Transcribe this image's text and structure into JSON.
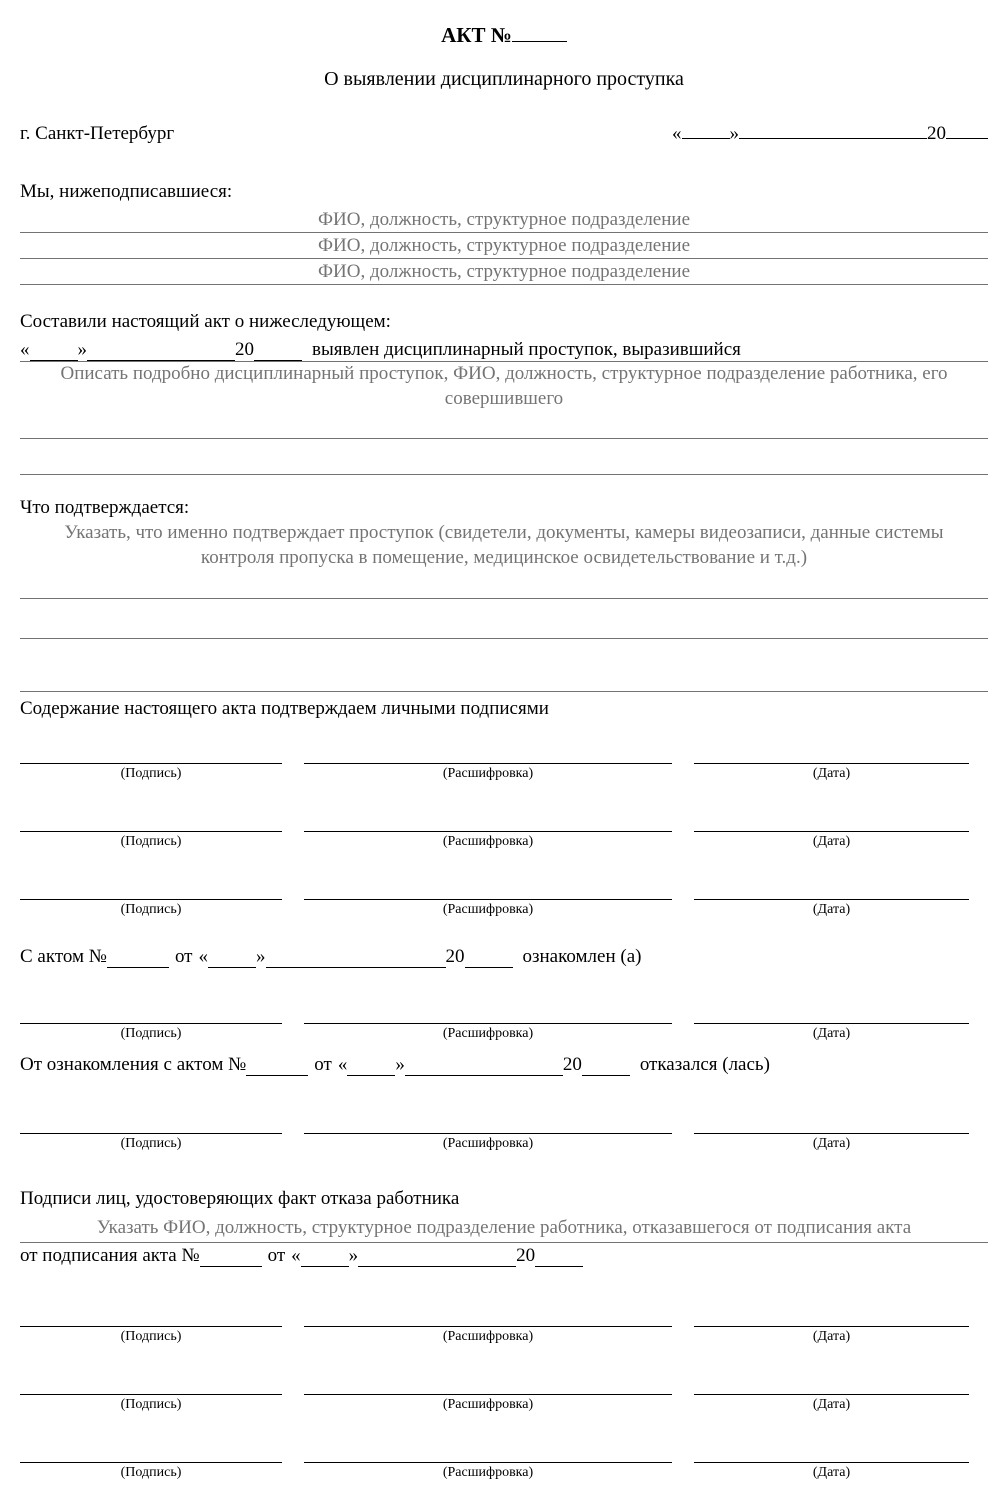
{
  "title_prefix": "АКТ №",
  "subtitle": "О выявлении дисциплинарного проступка",
  "city": "г. Санкт-Петербург",
  "date_open_quote": "«",
  "date_close_quote": "»",
  "year_prefix": "20",
  "signatories_intro": "Мы, нижеподписавшиеся:",
  "fio_placeholder": "ФИО, должность, структурное подразделение",
  "composed_intro": "Составили настоящий акт о нижеследующем:",
  "misconduct_suffix": "выявлен дисциплинарный проступок, выразившийся",
  "misconduct_hint": "Описать подробно дисциплинарный проступок, ФИО, должность, структурное подразделение работника, его совершившего",
  "confirmed_label": "Что подтверждается:",
  "confirmed_hint": "Указать, что именно подтверждает проступок (свидетели, документы, камеры видеозаписи, данные системы контроля пропуска в помещение, медицинское освидетельствование и т.д.)",
  "content_confirm": "Содержание настоящего акта подтверждаем личными подписями",
  "sig_label": "(Подпись)",
  "name_label": "(Расшифровка)",
  "date_label": "(Дата)",
  "ack_prefix": "С актом №",
  "from_word": "от",
  "ack_suffix": "ознакомлен (а)",
  "refuse_prefix": "От ознакомления с актом №",
  "refuse_suffix": "отказался (лась)",
  "refusal_sig_intro": "Подписи лиц, удостоверяющих факт отказа работника",
  "refusal_hint": "Указать ФИО, должность, структурное подразделение работника, отказавшегося от подписания акта",
  "refusal_act_prefix": "от подписания акта №"
}
